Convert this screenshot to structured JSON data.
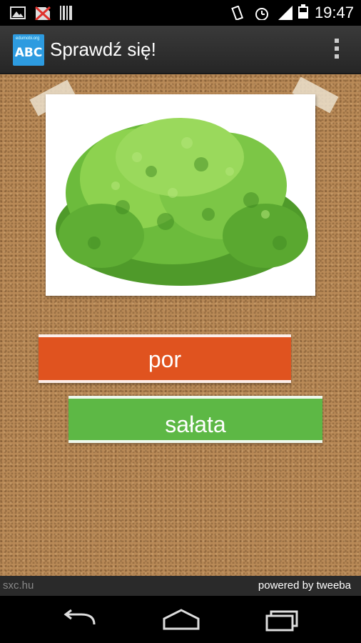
{
  "status_bar": {
    "time": "19:47",
    "icons": [
      "image-icon",
      "no-sim-icon",
      "barcode-icon",
      "vibrate-icon",
      "alarm-icon",
      "signal-icon",
      "battery-icon"
    ]
  },
  "action_bar": {
    "app_icon_small_text": "edumobi.org",
    "app_icon_text": "ABC",
    "title": "Sprawdź się!",
    "overflow_icon": "overflow-menu-icon"
  },
  "quiz": {
    "image_subject": "lettuce",
    "options": [
      {
        "label": "por",
        "color": "#e0531f"
      },
      {
        "label": "sałata",
        "color": "#5db845"
      }
    ]
  },
  "footer": {
    "left_credit": "sxc.hu",
    "right_credit": "powered by tweeba"
  },
  "nav_bar": {
    "buttons": [
      "back-icon",
      "home-icon",
      "recents-icon"
    ]
  }
}
